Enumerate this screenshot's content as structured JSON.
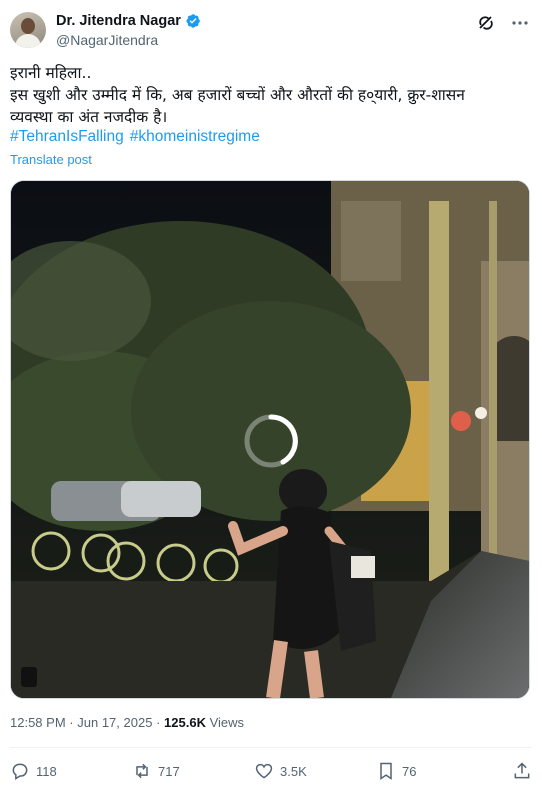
{
  "author": {
    "name": "Dr. Jitendra Nagar",
    "handle": "@NagarJitendra",
    "verified_color": "#1d9bf0"
  },
  "header_icons": [
    "grok-icon",
    "more-icon"
  ],
  "post": {
    "text": "इरानी महिला..\nइस खुशी और उम्मीद में कि, अब हजारों बच्चों और औरतों की ह०्यारी, क्रुर-शासन\nव्यवस्था का अंत नजदीक है।",
    "hashtags": [
      "#TehranIsFalling",
      "#khomeinistregime"
    ],
    "translate_label": "Translate post"
  },
  "media": {
    "type": "video",
    "state": "loading"
  },
  "meta": {
    "time": "12:58 PM",
    "separator": "·",
    "date": "Jun 17, 2025",
    "views_count": "125.6K",
    "views_label": "Views"
  },
  "actions": {
    "replies": "118",
    "reposts": "717",
    "likes": "3.5K",
    "bookmarks": "76"
  },
  "colors": {
    "link": "#1d9bf0",
    "secondary_text": "#536471",
    "primary_text": "#0f1419"
  }
}
